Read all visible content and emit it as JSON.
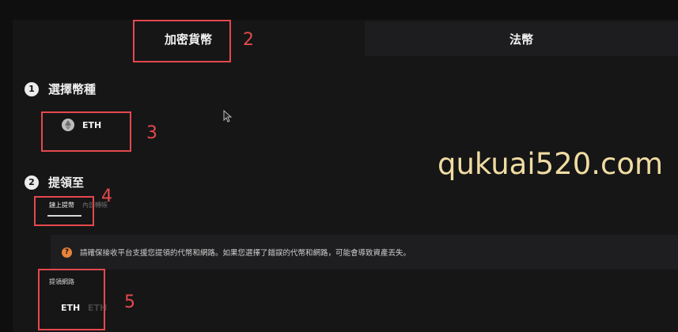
{
  "tabs": {
    "crypto_label": "加密貨幣",
    "fiat_label": "法幣"
  },
  "step1": {
    "number": "1",
    "title": "選擇幣種"
  },
  "coin": {
    "symbol": "ETH",
    "icon": "ethereum-icon"
  },
  "step2": {
    "number": "2",
    "title": "提領至"
  },
  "subtabs": {
    "onchain_label": "鏈上提幣",
    "internal_label": "內部轉帳"
  },
  "warning": {
    "icon": "warning-icon",
    "text": "請確保接收平台支援您提領的代幣和網路。如果您選擇了錯誤的代幣和網路，可能會導致資產丟失。"
  },
  "network": {
    "label": "提領網路",
    "value": "ETH",
    "next_option": "ETH"
  },
  "annotations": [
    "2",
    "3",
    "4",
    "5"
  ],
  "watermark": "qukuai520.com",
  "colors": {
    "annotation": "#e5484d",
    "watermark": "#f0dca2",
    "warning_icon": "#e8833a"
  }
}
